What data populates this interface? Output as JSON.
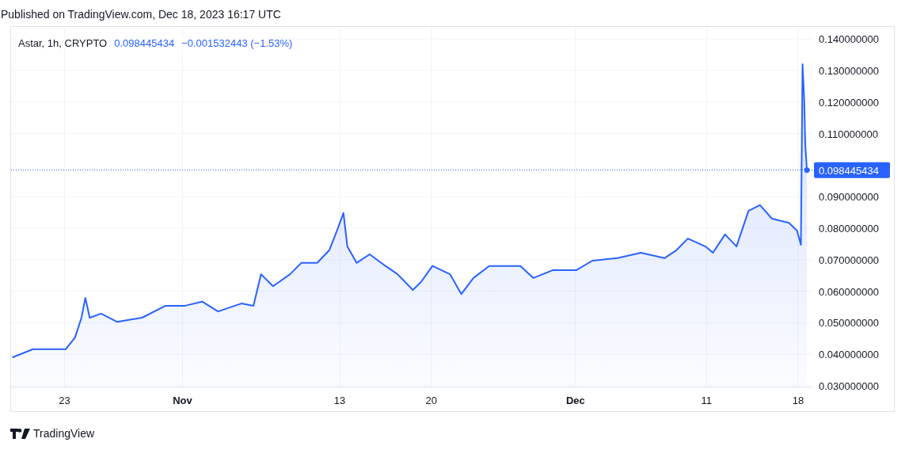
{
  "header": {
    "published": "Published on TradingView.com, Dec 18, 2023 16:17 UTC"
  },
  "chart": {
    "legend": {
      "symbol": "Astar, 1h, CRYPTO",
      "price": "0.098445434",
      "change": "−0.001532443 (−1.53%)"
    },
    "last_price_label": "0.098445434",
    "chart_data": {
      "type": "area",
      "grid": true,
      "ref_lines": [
        {
          "axis": "y",
          "value": 0.098445434,
          "color": "#2962ff"
        }
      ],
      "xlim": [
        "2023-10-18T22:00",
        "2023-12-19T02:00"
      ],
      "ylim": [
        0.0295,
        0.1438
      ],
      "xticks": [
        {
          "value": "2023-10-23T00:00",
          "label": "23"
        },
        {
          "value": "2023-11-01T00:00",
          "label": "Nov"
        },
        {
          "value": "2023-11-13T00:00",
          "label": "13"
        },
        {
          "value": "2023-11-20T00:00",
          "label": "20"
        },
        {
          "value": "2023-12-01T00:00",
          "label": "Dec"
        },
        {
          "value": "2023-12-11T00:00",
          "label": "11"
        },
        {
          "value": "2023-12-18T00:00",
          "label": "18"
        }
      ],
      "yticks": [
        {
          "value": 0.14,
          "label": "0.140000000"
        },
        {
          "value": 0.13,
          "label": "0.130000000"
        },
        {
          "value": 0.12,
          "label": "0.120000000"
        },
        {
          "value": 0.11,
          "label": "0.110000000"
        },
        {
          "value": 0.09,
          "label": "0.090000000"
        },
        {
          "value": 0.08,
          "label": "0.080000000"
        },
        {
          "value": 0.07,
          "label": "0.070000000"
        },
        {
          "value": 0.06,
          "label": "0.060000000"
        },
        {
          "value": 0.05,
          "label": "0.050000000"
        },
        {
          "value": 0.04,
          "label": "0.040000000"
        },
        {
          "value": 0.03,
          "label": "0.030000000"
        }
      ],
      "x": [
        "2023-10-19T00:00",
        "2023-10-20T14:00",
        "2023-10-23T02:00",
        "2023-10-23T19:00",
        "2023-10-24T07:00",
        "2023-10-24T14:00",
        "2023-10-24T22:00",
        "2023-10-25T19:00",
        "2023-10-27T00:00",
        "2023-10-28T22:00",
        "2023-10-30T17:00",
        "2023-11-01T05:00",
        "2023-11-02T12:00",
        "2023-11-03T17:00",
        "2023-11-05T12:00",
        "2023-11-06T10:00",
        "2023-11-07T00:00",
        "2023-11-07T22:00",
        "2023-11-09T05:00",
        "2023-11-10T02:00",
        "2023-11-11T07:00",
        "2023-11-12T05:00",
        "2023-11-12T19:00",
        "2023-11-13T07:00",
        "2023-11-13T14:00",
        "2023-11-14T07:00",
        "2023-11-15T07:00",
        "2023-11-16T12:00",
        "2023-11-17T10:00",
        "2023-11-18T14:00",
        "2023-11-19T05:00",
        "2023-11-20T02:00",
        "2023-11-21T10:00",
        "2023-11-22T07:00",
        "2023-11-23T05:00",
        "2023-11-24T10:00",
        "2023-11-25T14:00",
        "2023-11-26T19:00",
        "2023-11-27T19:00",
        "2023-11-29T07:00",
        "2023-12-01T02:00",
        "2023-12-02T07:00",
        "2023-12-04T05:00",
        "2023-12-06T00:00",
        "2023-12-07T19:00",
        "2023-12-08T17:00",
        "2023-12-09T14:00",
        "2023-12-10T22:00",
        "2023-12-11T12:00",
        "2023-12-12T10:00",
        "2023-12-13T07:00",
        "2023-12-14T05:00",
        "2023-12-15T02:00",
        "2023-12-16T00:00",
        "2023-12-17T07:00",
        "2023-12-17T22:00",
        "2023-12-18T05:00",
        "2023-12-18T08:00",
        "2023-12-18T11:00",
        "2023-12-18T13:00",
        "2023-12-18T16:00"
      ],
      "series": [
        {
          "color": "#2962ff",
          "values": [
            0.039,
            0.0416,
            0.0416,
            0.0453,
            0.0516,
            0.0579,
            0.0516,
            0.0529,
            0.0503,
            0.0516,
            0.0554,
            0.0554,
            0.0567,
            0.0536,
            0.0561,
            0.0554,
            0.0654,
            0.0616,
            0.0654,
            0.069,
            0.069,
            0.073,
            0.0792,
            0.0848,
            0.0742,
            0.069,
            0.0717,
            0.068,
            0.0654,
            0.0604,
            0.0629,
            0.068,
            0.0654,
            0.0591,
            0.0642,
            0.068,
            0.068,
            0.068,
            0.0642,
            0.0667,
            0.0667,
            0.0697,
            0.0705,
            0.0722,
            0.0705,
            0.073,
            0.0767,
            0.0742,
            0.0722,
            0.078,
            0.0742,
            0.0855,
            0.0873,
            0.083,
            0.0817,
            0.0792,
            0.0747,
            0.132,
            0.1207,
            0.1068,
            0.0984
          ]
        }
      ]
    }
  },
  "footer": {
    "brand": "TradingView"
  }
}
